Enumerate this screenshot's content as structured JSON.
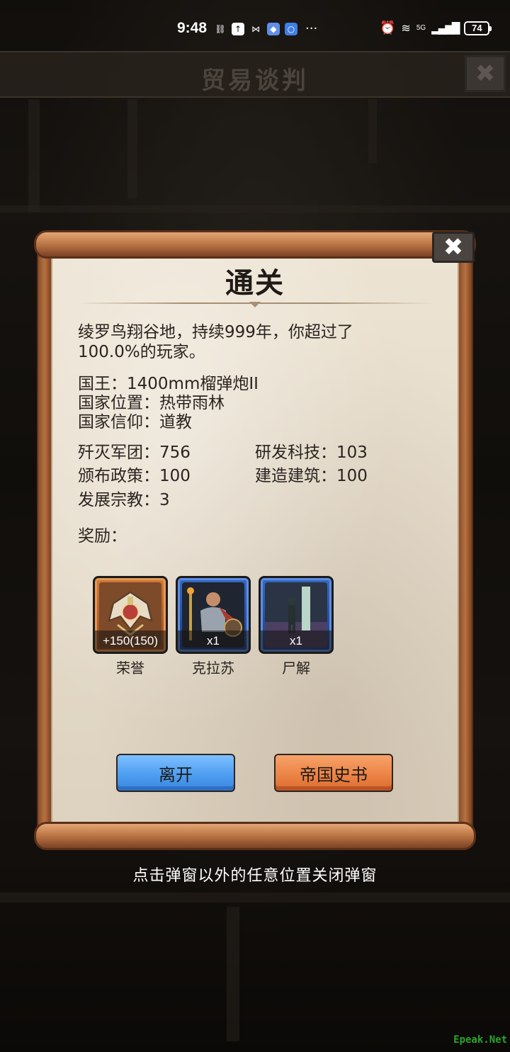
{
  "status_bar": {
    "time": "9:48",
    "more": "···",
    "battery": "74",
    "signal_label": "5G"
  },
  "background": {
    "header_title": "贸易谈判",
    "close_glyph": "✖"
  },
  "dialog": {
    "close_glyph": "✖",
    "title": "通关",
    "summary_line1": "绫罗鸟翔谷地，持续999年，你超过了",
    "summary_line2": "100.0%的玩家。",
    "king": "国王：1400mm榴弹炮II",
    "location": "国家位置：热带雨林",
    "faith": "国家信仰：道教",
    "stats": [
      {
        "label": "歼灭军团：756"
      },
      {
        "label": "研发科技：103"
      },
      {
        "label": "颁布政策：100"
      },
      {
        "label": "建造建筑：100"
      },
      {
        "label": "发展宗教：3"
      }
    ],
    "rewards_label": "奖励：",
    "rewards": [
      {
        "qty": "+150(150)",
        "name": "荣誉",
        "frame": "orange"
      },
      {
        "qty": "x1",
        "name": "克拉苏",
        "frame": "blue"
      },
      {
        "qty": "x1",
        "name": "尸解",
        "frame": "blue"
      }
    ],
    "buttons": {
      "leave": "离开",
      "history": "帝国史书"
    }
  },
  "hint": "点击弹窗以外的任意位置关闭弹窗",
  "watermark": "Epeak.Net"
}
